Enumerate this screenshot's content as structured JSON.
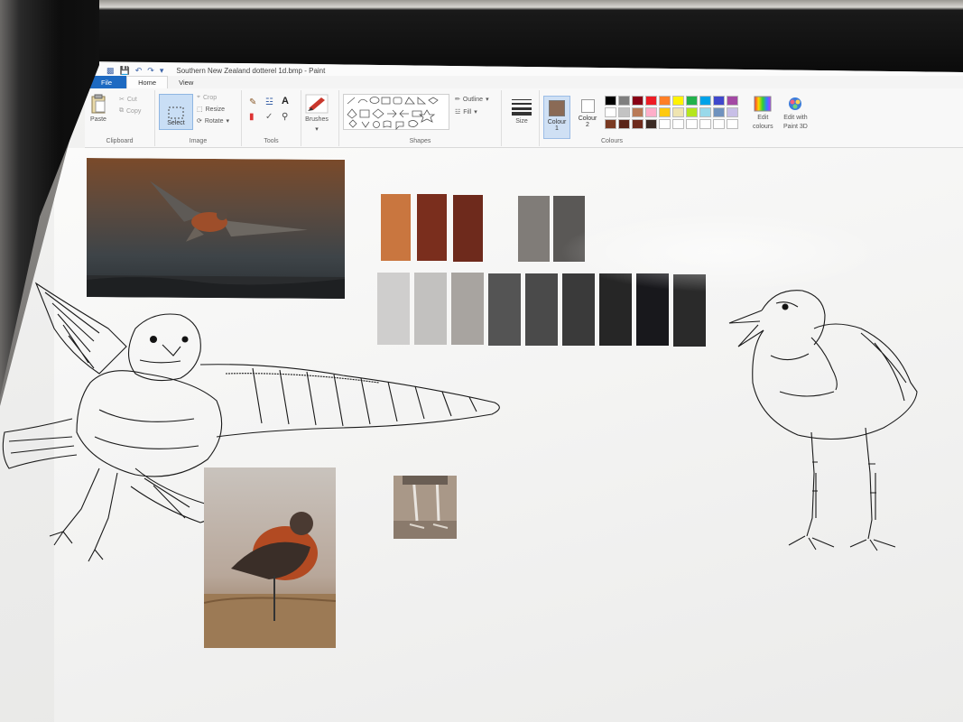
{
  "window": {
    "title": "Southern New Zealand dotterel 1d.bmp - Paint"
  },
  "tabs": [
    {
      "label": "File"
    },
    {
      "label": "Home"
    },
    {
      "label": "View"
    }
  ],
  "ribbon": {
    "clipboard": {
      "label": "Clipboard",
      "paste": "Paste",
      "cut": "Cut",
      "copy": "Copy"
    },
    "image": {
      "label": "Image",
      "select": "Select",
      "crop": "Crop",
      "resize": "Resize",
      "rotate": "Rotate"
    },
    "tools": {
      "label": "Tools"
    },
    "brushes": {
      "label": "Brushes"
    },
    "shapes": {
      "label": "Shapes",
      "outline": "Outline",
      "fill": "Fill"
    },
    "size": {
      "label": "Size"
    },
    "colours": {
      "label": "Colours",
      "colour1_line1": "Colour",
      "colour1_line2": "1",
      "colour2_line1": "Colour",
      "colour2_line2": "2",
      "edit_line1": "Edit",
      "edit_line2": "colours",
      "paint3d_line1": "Edit with",
      "paint3d_line2": "Paint 3D",
      "palette_row1": [
        "#000000",
        "#7f7f7f",
        "#880015",
        "#ed1c24",
        "#ff7f27",
        "#fff200",
        "#22b14c",
        "#00a2e8",
        "#3f48cc",
        "#a349a4"
      ],
      "palette_row2": [
        "#ffffff",
        "#c3c3c3",
        "#b97a57",
        "#ffaec9",
        "#ffc90e",
        "#efe4b0",
        "#b5e61d",
        "#99d9ea",
        "#7092be",
        "#c8bfe7"
      ],
      "palette_row3": [
        "#7a3a22",
        "#5a2418",
        "#6e2a1c",
        "#3b2a24",
        "#ffffff",
        "#ffffff",
        "#ffffff",
        "#ffffff",
        "#ffffff",
        "#ffffff"
      ],
      "colour1": "#8a6a55",
      "colour2": "#ffffff"
    }
  },
  "canvas": {
    "palette_warm": [
      "#c9763f",
      "#7a2e1d",
      "#6e2a1c"
    ],
    "palette_grey": [
      "#807c78",
      "#5a5856"
    ],
    "palette_greyscale": [
      "#cfcecd",
      "#c2c1bf",
      "#a8a4a0",
      "#545454",
      "#4a4a4a",
      "#3a3a3a",
      "#262626",
      "#18181c",
      "#2a2a2a"
    ]
  }
}
